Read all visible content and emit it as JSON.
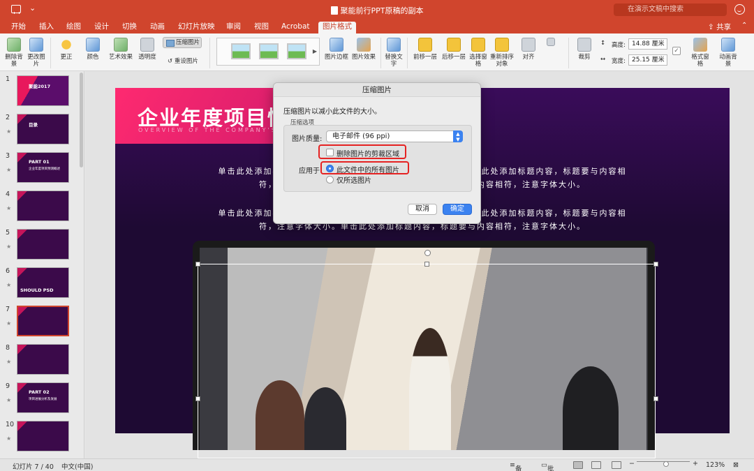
{
  "window": {
    "title": "聚能前行PPT原稿的副本",
    "search_placeholder": "在演示文稿中搜索"
  },
  "tabs": [
    {
      "label": "开始"
    },
    {
      "label": "插入"
    },
    {
      "label": "绘图"
    },
    {
      "label": "设计"
    },
    {
      "label": "切换"
    },
    {
      "label": "动画"
    },
    {
      "label": "幻灯片放映"
    },
    {
      "label": "审阅"
    },
    {
      "label": "视图"
    },
    {
      "label": "Acrobat"
    },
    {
      "label": "图片格式",
      "active": true
    }
  ],
  "share_label": "共享",
  "ribbon": {
    "remove_bg": "删除背景",
    "change_pic": "更改图片",
    "corrections": "更正",
    "color": "颜色",
    "artistic": "艺术效果",
    "transparency": "透明度",
    "compress": "压缩图片",
    "reset": "重设图片",
    "border": "图片边框",
    "effects": "图片效果",
    "alt_text": "替换文字",
    "bring_forward": "前移一层",
    "send_backward": "后移一层",
    "selection_pane": "选择窗格",
    "reorder": "重新排序对象",
    "align": "对齐",
    "crop": "裁剪",
    "height_label": "高度:",
    "height_value": "14.88 厘米",
    "width_label": "宽度:",
    "width_value": "25.15 厘米",
    "format_pane": "格式窗格",
    "animated_bg": "动画背景"
  },
  "thumbnails": [
    {
      "num": "1",
      "star": "",
      "title": "聚能2017",
      "sub": ""
    },
    {
      "num": "2",
      "star": "★",
      "title": "目录",
      "sub": ""
    },
    {
      "num": "3",
      "star": "★",
      "title": "PART 01",
      "sub": "企业年度项目预测概述"
    },
    {
      "num": "4",
      "star": "★",
      "title": "",
      "sub": ""
    },
    {
      "num": "5",
      "star": "★",
      "title": "",
      "sub": ""
    },
    {
      "num": "6",
      "star": "★",
      "title": "SHOULD PSD",
      "sub": ""
    },
    {
      "num": "7",
      "star": "★",
      "title": "",
      "sub": "",
      "selected": true
    },
    {
      "num": "8",
      "star": "★",
      "title": "",
      "sub": ""
    },
    {
      "num": "9",
      "star": "★",
      "title": "PART 02",
      "sub": "项目进展分析及发展"
    },
    {
      "num": "10",
      "star": "★",
      "title": "",
      "sub": ""
    }
  ],
  "slide": {
    "title": "企业年度项目情",
    "subtitle": "OVERVIEW OF THE COMPANY'S ANN",
    "para1_line1": "单击此处添加标题内容，标题要与内容相符，注意字体大小。单击此处添加标题内容，标题要与内容相",
    "para1_line2": "符，注意字体大小。单击此处添加标题内容，标题要与内容相符，注意字体大小。",
    "para2_line1": "单击此处添加标题内容，标题要与内容相符，注意字体大小。单击此处添加标题内容，标题要与内容相",
    "para2_line2": "符，注意字体大小。单击此处添加标题内容，标题要与内容相符，注意字体大小。"
  },
  "dialog": {
    "title": "压缩图片",
    "description": "压缩图片以减小此文件的大小。",
    "group_label": "压缩选项",
    "quality_label": "图片质量:",
    "quality_value": "电子邮件 (96 ppi)",
    "delete_crop_label": "删除图片的剪裁区域",
    "delete_crop_checked": false,
    "apply_label": "应用于",
    "apply_all_label": "此文件中的所有图片",
    "apply_selected_label": "仅所选图片",
    "apply_value": "all",
    "cancel_label": "取消",
    "ok_label": "确定",
    "highlight_color": "#e52222",
    "accent_color": "#3b82f0"
  },
  "status": {
    "slide_info": "幻灯片 7 / 40",
    "language": "中文(中国)",
    "notes_label": "备注",
    "comments_label": "批注",
    "zoom": "123%",
    "zoom_fraction": 0.5
  },
  "colors": {
    "titlebar": "#d0452d",
    "slide_bg": "#1e0a33",
    "slide_accent": "#ff2a70"
  }
}
